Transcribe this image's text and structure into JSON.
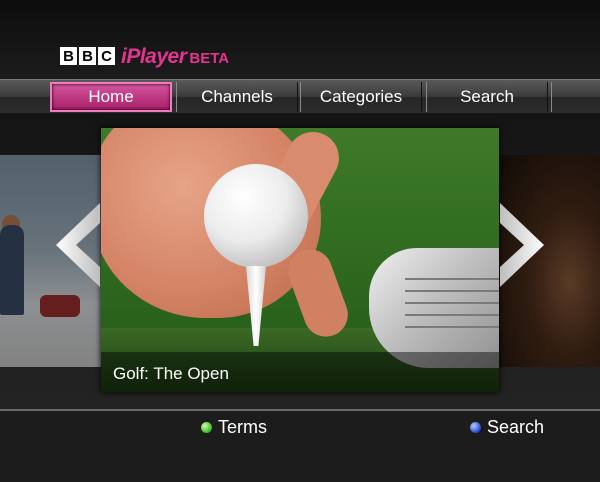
{
  "logo": {
    "bbc_letters": [
      "B",
      "B",
      "C"
    ],
    "product": "iPlayer",
    "badge": "BETA",
    "brand_color": "#e3348f"
  },
  "nav": {
    "items": [
      {
        "label": "Home",
        "selected": true
      },
      {
        "label": "Channels",
        "selected": false
      },
      {
        "label": "Categories",
        "selected": false
      },
      {
        "label": "Search",
        "selected": false
      }
    ]
  },
  "carousel": {
    "featured": {
      "title": "Golf: The Open"
    },
    "left_arrow_icon": "chevron-left-icon",
    "right_arrow_icon": "chevron-right-icon"
  },
  "footer": {
    "terms": {
      "label": "Terms",
      "dot_color": "#3fbf2a"
    },
    "search": {
      "label": "Search",
      "dot_color": "#2a50e0"
    }
  }
}
